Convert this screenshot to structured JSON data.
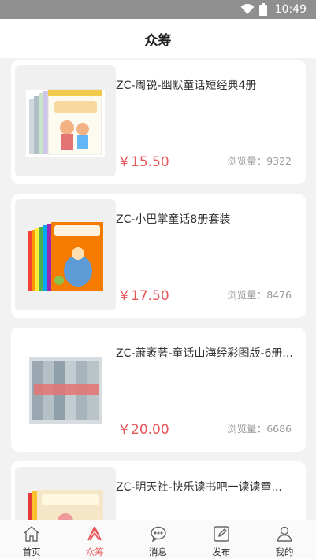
{
  "status_bar": {
    "time": "10:49",
    "wifi_icon": "wifi-icon",
    "battery_icon": "battery-icon"
  },
  "header": {
    "title": "众筹"
  },
  "products": [
    {
      "title": "ZC-周锐-幽默童话短经典4册",
      "price": "￥15.50",
      "views": "浏览量：9322"
    },
    {
      "title": "ZC-小巴掌童话8册套装",
      "price": "￥17.50",
      "views": "浏览量：8476"
    },
    {
      "title": "ZC-萧袤著-童话山海经彩图版-6册...",
      "price": "￥20.00",
      "views": "浏览量：6686"
    },
    {
      "title": "ZC-明天社-快乐读书吧一读读童...",
      "price": "",
      "views": ""
    }
  ],
  "tabs": [
    {
      "label": "首页",
      "icon": "home-icon"
    },
    {
      "label": "众筹",
      "icon": "crowdfund-icon",
      "active": true
    },
    {
      "label": "消息",
      "icon": "message-icon"
    },
    {
      "label": "发布",
      "icon": "publish-icon"
    },
    {
      "label": "我的",
      "icon": "profile-icon"
    }
  ],
  "colors": {
    "accent": "#e8565a",
    "status_bar": "#8f8f8f"
  }
}
